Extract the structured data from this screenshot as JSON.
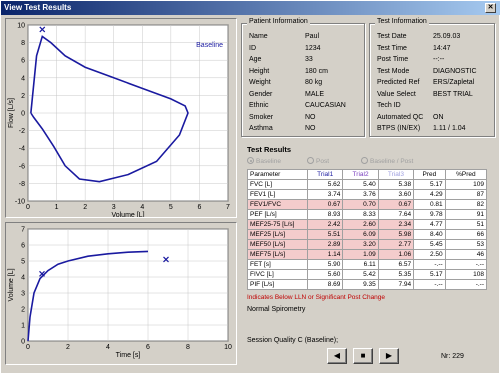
{
  "window": {
    "title": "View Test Results"
  },
  "flow_volume": {
    "y_ticks": [
      "10",
      "8",
      "6",
      "4",
      "2",
      "0",
      "-2",
      "-4",
      "-6",
      "-8",
      "-10"
    ],
    "x_ticks": [
      "0",
      "1",
      "2",
      "3",
      "4",
      "5",
      "6",
      "7"
    ],
    "ylabel": "Flow [L/s]",
    "xlabel": "Volume [L]",
    "legend": "Baseline"
  },
  "volume_time": {
    "y_ticks": [
      "7",
      "6",
      "5",
      "4",
      "3",
      "2",
      "1",
      "0"
    ],
    "x_ticks": [
      "0",
      "2",
      "4",
      "6",
      "8",
      "10"
    ],
    "ylabel": "Volume [L]",
    "xlabel": "Time [s]"
  },
  "chart_data": [
    {
      "type": "line",
      "title": "",
      "xlabel": "Volume [L]",
      "ylabel": "Flow [L/s]",
      "xlim": [
        0,
        7
      ],
      "ylim": [
        -10,
        10
      ],
      "grid": true,
      "legend": "Baseline",
      "series": [
        {
          "name": "Baseline",
          "x": [
            0.1,
            0.3,
            0.5,
            0.8,
            1.3,
            2.0,
            3.0,
            4.0,
            5.0,
            5.5,
            5.6,
            5.3,
            4.5,
            3.5,
            2.5,
            1.8,
            1.3,
            0.9,
            0.5,
            0.2,
            0.1
          ],
          "y": [
            0,
            6.5,
            8.7,
            8.0,
            6.5,
            5.2,
            4.0,
            2.8,
            1.6,
            0.8,
            0,
            -2.5,
            -5.5,
            -7.0,
            -7.8,
            -7.5,
            -6.0,
            -3.8,
            -1.8,
            -0.5,
            0
          ]
        }
      ],
      "markers": [
        {
          "x": 0.5,
          "y": 9.5
        }
      ]
    },
    {
      "type": "line",
      "title": "",
      "xlabel": "Time [s]",
      "ylabel": "Volume [L]",
      "xlim": [
        0,
        10
      ],
      "ylim": [
        0,
        7
      ],
      "grid": true,
      "series": [
        {
          "name": "",
          "x": [
            0,
            0.1,
            0.3,
            0.6,
            1.0,
            1.5,
            2.0,
            3.0,
            4.0,
            5.0,
            6.0
          ],
          "y": [
            0,
            1.5,
            3.0,
            3.9,
            4.4,
            4.8,
            5.0,
            5.3,
            5.45,
            5.55,
            5.6
          ]
        }
      ],
      "markers": [
        {
          "x": 0.7,
          "y": 4.2
        },
        {
          "x": 6.9,
          "y": 5.1
        }
      ]
    }
  ],
  "patient": {
    "title": "Patient Information",
    "rows": [
      {
        "label": "Name",
        "value": "Paul"
      },
      {
        "label": "ID",
        "value": "1234"
      },
      {
        "label": "Age",
        "value": "33"
      },
      {
        "label": "Height",
        "value": "180 cm"
      },
      {
        "label": "Weight",
        "value": "80 kg"
      },
      {
        "label": "Gender",
        "value": "MALE"
      },
      {
        "label": "Ethnic",
        "value": "CAUCASIAN"
      },
      {
        "label": "Smoker",
        "value": "NO"
      },
      {
        "label": "Asthma",
        "value": "NO"
      }
    ]
  },
  "test": {
    "title": "Test Information",
    "rows": [
      {
        "label": "Test Date",
        "value": "25.09.03"
      },
      {
        "label": "Test Time",
        "value": "14:47"
      },
      {
        "label": "Post Time",
        "value": "--:--"
      },
      {
        "label": "Test Mode",
        "value": "DIAGNOSTIC"
      },
      {
        "label": "Predicted Ref",
        "value": "ERS/Zapletal"
      },
      {
        "label": "Value Select",
        "value": "BEST TRIAL"
      },
      {
        "label": "Tech ID",
        "value": ""
      },
      {
        "label": "Automated QC",
        "value": "ON"
      },
      {
        "label": "BTPS (IN/EX)",
        "value": "1.11 / 1.04"
      }
    ]
  },
  "results": {
    "title": "Test Results",
    "radio_baseline": "Baseline",
    "radio_post": "Post",
    "radio_both": "Baseline / Post",
    "headers": [
      "Parameter",
      "Trial1",
      "Trial2",
      "Trial3",
      "Pred",
      "%Pred"
    ],
    "rows": [
      {
        "p": "FVC [L]",
        "t1": "5.62",
        "t2": "5.40",
        "t3": "5.38",
        "pred": "5.17",
        "pct": "109",
        "flag": false
      },
      {
        "p": "FEV1 [L]",
        "t1": "3.74",
        "t2": "3.76",
        "t3": "3.60",
        "pred": "4.29",
        "pct": "87",
        "flag": false
      },
      {
        "p": "FEV1/FVC",
        "t1": "0.67",
        "t2": "0.70",
        "t3": "0.67",
        "pred": "0.81",
        "pct": "82",
        "flag": true
      },
      {
        "p": "PEF [L/s]",
        "t1": "8.93",
        "t2": "8.33",
        "t3": "7.64",
        "pred": "9.78",
        "pct": "91",
        "flag": false
      },
      {
        "p": "MEF25-75 [L/s]",
        "t1": "2.42",
        "t2": "2.60",
        "t3": "2.34",
        "pred": "4.77",
        "pct": "51",
        "flag": true
      },
      {
        "p": "MEF25 [L/s]",
        "t1": "5.51",
        "t2": "6.09",
        "t3": "5.98",
        "pred": "8.40",
        "pct": "66",
        "flag": true
      },
      {
        "p": "MEF50 [L/s]",
        "t1": "2.89",
        "t2": "3.20",
        "t3": "2.77",
        "pred": "5.45",
        "pct": "53",
        "flag": true
      },
      {
        "p": "MEF75 [L/s]",
        "t1": "1.14",
        "t2": "1.09",
        "t3": "1.06",
        "pred": "2.50",
        "pct": "46",
        "flag": true
      },
      {
        "p": "FET [s]",
        "t1": "5.90",
        "t2": "6.11",
        "t3": "6.57",
        "pred": "-.--",
        "pct": "-.--",
        "flag": false
      },
      {
        "p": "FIVC [L]",
        "t1": "5.60",
        "t2": "5.42",
        "t3": "5.35",
        "pred": "5.17",
        "pct": "108",
        "flag": false
      },
      {
        "p": "PIF [L/s]",
        "t1": "8.69",
        "t2": "9.35",
        "t3": "7.94",
        "pred": "-.--",
        "pct": "-.--",
        "flag": false
      }
    ],
    "warning": "Indicates Below LLN or Significant Post Change",
    "interpretation": "Normal Spirometry",
    "session_quality": "Session Quality  C (Baseline);"
  },
  "nav": {
    "prev": "◀",
    "stop": "■",
    "next": "▶",
    "record": "Nr: 229"
  },
  "colors": {
    "curve": "#1a1aa0",
    "flag": "#f4cccc",
    "warn": "#c00000",
    "title_start": "#0a246a",
    "title_end": "#a6caf0"
  }
}
